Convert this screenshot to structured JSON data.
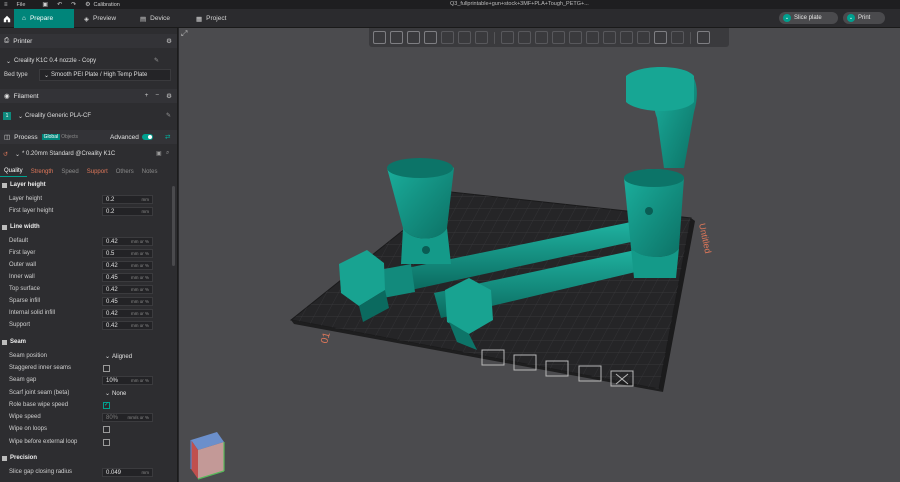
{
  "titlebar": {
    "file_menu": "File",
    "calibration": "Calibration",
    "window_title": "Q3_fullprintable+gun+stock+3MF+PLA+Tough_PETG+..."
  },
  "tabs": [
    {
      "label": "Prepare",
      "active": true
    },
    {
      "label": "Preview",
      "active": false
    },
    {
      "label": "Device",
      "active": false
    },
    {
      "label": "Project",
      "active": false
    }
  ],
  "actions": {
    "slice": "Slice plate",
    "print": "Print"
  },
  "printer": {
    "heading": "Printer",
    "name": "Creality K1C 0.4 nozzle - Copy",
    "bed_type_label": "Bed type",
    "bed_type_value": "Smooth PEI Plate / High Temp Plate"
  },
  "filament": {
    "heading": "Filament",
    "slot": "1",
    "name": "Creality Generic PLA-CF"
  },
  "process": {
    "heading": "Process",
    "toggle_global": "Global",
    "toggle_objects": "Objects",
    "advanced": "Advanced",
    "preset": "* 0.20mm Standard @Creality K1C",
    "tabs": [
      "Quality",
      "Strength",
      "Speed",
      "Support",
      "Others",
      "Notes"
    ]
  },
  "layer_height": {
    "title": "Layer height",
    "rows": [
      {
        "label": "Layer height",
        "value": "0.2",
        "unit": "mm"
      },
      {
        "label": "First layer height",
        "value": "0.2",
        "unit": "mm"
      }
    ]
  },
  "line_width": {
    "title": "Line width",
    "rows": [
      {
        "label": "Default",
        "value": "0.42",
        "unit": "mm or %"
      },
      {
        "label": "First layer",
        "value": "0.5",
        "unit": "mm or %"
      },
      {
        "label": "Outer wall",
        "value": "0.42",
        "unit": "mm or %"
      },
      {
        "label": "Inner wall",
        "value": "0.45",
        "unit": "mm or %"
      },
      {
        "label": "Top surface",
        "value": "0.42",
        "unit": "mm or %"
      },
      {
        "label": "Sparse infill",
        "value": "0.45",
        "unit": "mm or %"
      },
      {
        "label": "Internal solid infill",
        "value": "0.42",
        "unit": "mm or %"
      },
      {
        "label": "Support",
        "value": "0.42",
        "unit": "mm or %"
      }
    ]
  },
  "seam": {
    "title": "Seam",
    "seam_position_label": "Seam position",
    "seam_position_value": "Aligned",
    "staggered_label": "Staggered inner seams",
    "seam_gap_label": "Seam gap",
    "seam_gap_value": "10%",
    "seam_gap_unit": "mm or %",
    "scarf_label": "Scarf joint seam (beta)",
    "scarf_value": "None",
    "role_wipe_label": "Role base wipe speed",
    "wipe_speed_label": "Wipe speed",
    "wipe_speed_value": "80%",
    "wipe_speed_unit": "mm/s or %",
    "wipe_loops_label": "Wipe on loops",
    "wipe_before_label": "Wipe before external loop"
  },
  "precision": {
    "title": "Precision",
    "slice_gap_label": "Slice gap closing radius",
    "slice_gap_value": "0.049",
    "slice_gap_unit": "mm"
  },
  "viewport": {
    "plate_label": "Untitled",
    "plate_number": "01",
    "colors": {
      "model": "#16998a",
      "model_dark": "#0f6f64",
      "plate": "#2b2b2d",
      "accent": "#e0785a"
    }
  }
}
